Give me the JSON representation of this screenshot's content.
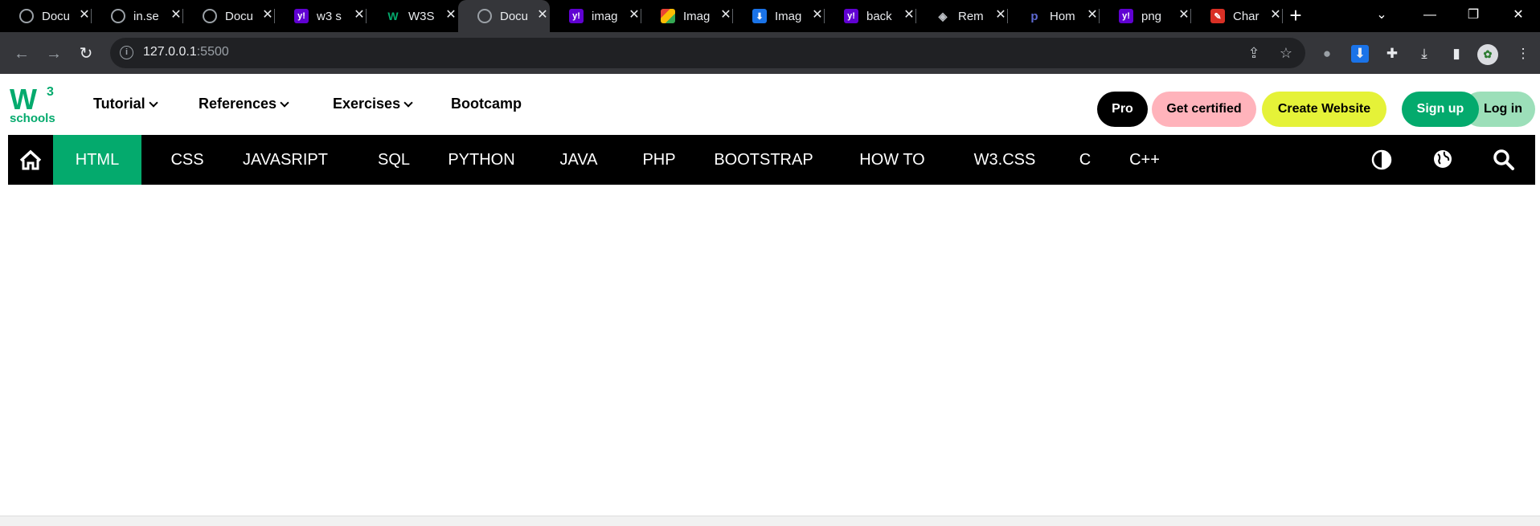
{
  "browser": {
    "tabs": [
      {
        "favicon": "globe-icon",
        "title": "Docu"
      },
      {
        "favicon": "globe-icon",
        "title": "in.se"
      },
      {
        "favicon": "globe-icon",
        "title": "Docu"
      },
      {
        "favicon": "yahoo-icon",
        "title": "w3 s"
      },
      {
        "favicon": "w3schools-icon",
        "title": "W3S"
      },
      {
        "favicon": "globe-icon",
        "title": "Docu",
        "active": true
      },
      {
        "favicon": "yahoo-icon",
        "title": "imag"
      },
      {
        "favicon": "image-icon",
        "title": "Imag"
      },
      {
        "favicon": "download-icon",
        "title": "Imag"
      },
      {
        "favicon": "yahoo-icon",
        "title": "back"
      },
      {
        "favicon": "layers-icon",
        "title": "Rem"
      },
      {
        "favicon": "home-icon",
        "title": "Hom"
      },
      {
        "favicon": "yahoo-icon",
        "title": "png"
      },
      {
        "favicon": "tool-icon",
        "title": "Char"
      }
    ],
    "new_tab_label": "+",
    "url_host": "127.0.0.1",
    "url_port": ":5500"
  },
  "site": {
    "logo_w": "W",
    "logo_sup": "3",
    "logo_sub": "schools",
    "top_menu": [
      "Tutorial",
      "References",
      "Exercises",
      "Bootcamp"
    ],
    "buttons": {
      "pro": "Pro",
      "certified": "Get certified",
      "create": "Create Website",
      "signup": "Sign up",
      "login": "Log in"
    },
    "nav_items": [
      "HTML",
      "CSS",
      "JAVASRIPT",
      "SQL",
      "PYTHON",
      "JAVA",
      "PHP",
      "BOOTSTRAP",
      "HOW TO",
      "W3.CSS",
      "C",
      "C++"
    ],
    "active_nav": "HTML",
    "colors": {
      "brand_green": "#04aa6d",
      "nav_bg": "#000000",
      "cert_pink": "#ffb3bb",
      "create_yellow": "#e5f238",
      "login_mint": "#9cdfb9"
    }
  }
}
